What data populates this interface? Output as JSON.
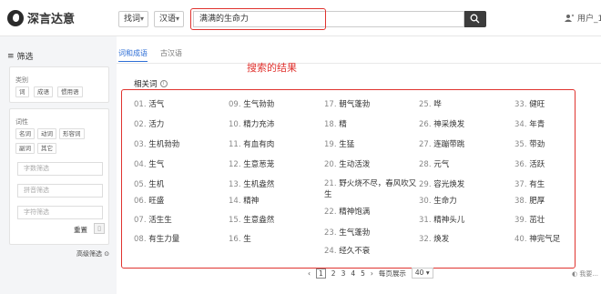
{
  "header": {
    "logo_text": "深言达意",
    "select_mode": "找词",
    "select_lang": "汉语",
    "search_value": "满满的生命力",
    "user_label": "用户_1"
  },
  "sidebar": {
    "title": "筛选",
    "category_label": "类别",
    "category_chips": [
      "词",
      "成语",
      "惯用语"
    ],
    "pos_label": "词性",
    "pos_chips": [
      "名词",
      "动词",
      "形容词",
      "副词",
      "其它"
    ],
    "inputs": [
      "字数筛选",
      "拼音筛选",
      "字符筛选"
    ],
    "reset_label": "重置",
    "advanced_label": "高级筛选"
  },
  "main": {
    "tabs": [
      "词和成语",
      "古汉语"
    ],
    "annotation": "搜索的结果",
    "related_title": "相关词",
    "columns": [
      [
        {
          "num": "01.",
          "text": "活气"
        },
        {
          "num": "02.",
          "text": "活力"
        },
        {
          "num": "03.",
          "text": "生机勃勃"
        },
        {
          "num": "04.",
          "text": "生气"
        },
        {
          "num": "05.",
          "text": "生机"
        },
        {
          "num": "06.",
          "text": "旺盛"
        },
        {
          "num": "07.",
          "text": "活生生"
        },
        {
          "num": "08.",
          "text": "有生力量"
        }
      ],
      [
        {
          "num": "09.",
          "text": "生气勃勃"
        },
        {
          "num": "10.",
          "text": "精力充沛"
        },
        {
          "num": "11.",
          "text": "有血有肉"
        },
        {
          "num": "12.",
          "text": "生意葱茏"
        },
        {
          "num": "13.",
          "text": "生机盎然"
        },
        {
          "num": "14.",
          "text": "精神"
        },
        {
          "num": "15.",
          "text": "生意盎然"
        },
        {
          "num": "16.",
          "text": "生"
        }
      ],
      [
        {
          "num": "17.",
          "text": "朝气蓬勃"
        },
        {
          "num": "18.",
          "text": "精"
        },
        {
          "num": "19.",
          "text": "生猛"
        },
        {
          "num": "20.",
          "text": "生动活泼"
        },
        {
          "num": "21.",
          "text": "野火烧不尽，春风吹又生"
        },
        {
          "num": "22.",
          "text": "精神饱满"
        },
        {
          "num": "23.",
          "text": "生气蓬勃"
        },
        {
          "num": "24.",
          "text": "经久不衰"
        }
      ],
      [
        {
          "num": "25.",
          "text": "哗"
        },
        {
          "num": "26.",
          "text": "神采焕发"
        },
        {
          "num": "27.",
          "text": "连蹦带跳"
        },
        {
          "num": "28.",
          "text": "元气"
        },
        {
          "num": "29.",
          "text": "容光焕发"
        },
        {
          "num": "30.",
          "text": "生命力"
        },
        {
          "num": "31.",
          "text": "精神头儿"
        },
        {
          "num": "32.",
          "text": "焕发"
        }
      ],
      [
        {
          "num": "33.",
          "text": "健旺"
        },
        {
          "num": "34.",
          "text": "年青"
        },
        {
          "num": "35.",
          "text": "带劲"
        },
        {
          "num": "36.",
          "text": "活跃"
        },
        {
          "num": "37.",
          "text": "有生"
        },
        {
          "num": "38.",
          "text": "肥厚"
        },
        {
          "num": "39.",
          "text": "茁壮"
        },
        {
          "num": "40.",
          "text": "神完气足"
        }
      ]
    ]
  },
  "pagination": {
    "prev": "‹",
    "pages": [
      "1",
      "2",
      "3",
      "4",
      "5"
    ],
    "next": "›",
    "per_page_label": "每页展示",
    "per_page_value": "40"
  },
  "footer_tip": "我要..."
}
